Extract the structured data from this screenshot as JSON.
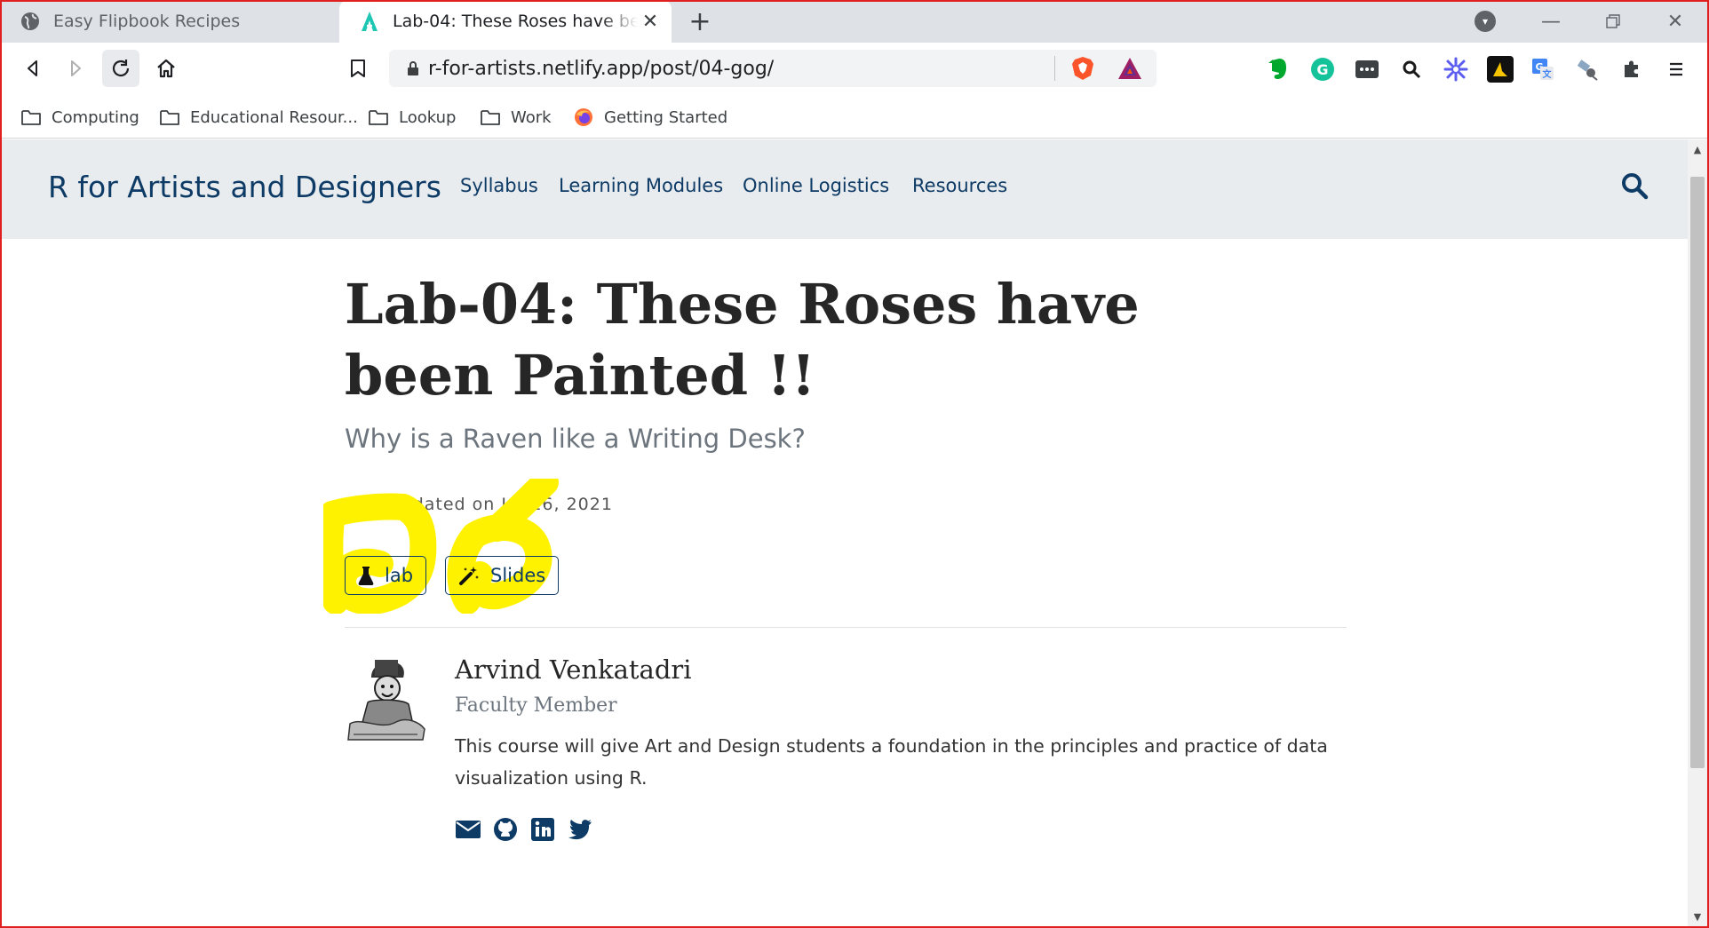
{
  "browser": {
    "tabs": [
      {
        "title": "Easy Flipbook Recipes",
        "favicon": "globe-icon",
        "active": false
      },
      {
        "title": "Lab-04: These Roses have been Pa",
        "favicon": "site-a-icon",
        "active": true
      }
    ],
    "new_tab_symbol": "+",
    "close_symbol": "✕",
    "url": "r-for-artists.netlify.app/post/04-gog/",
    "bookmarks": [
      {
        "label": "Computing",
        "icon": "folder-icon"
      },
      {
        "label": "Educational Resour...",
        "icon": "folder-icon"
      },
      {
        "label": "Lookup",
        "icon": "folder-icon"
      },
      {
        "label": "Work",
        "icon": "folder-icon"
      },
      {
        "label": "Getting Started",
        "icon": "firefox-icon"
      }
    ],
    "extensions": [
      "evernote-icon",
      "grammarly-icon",
      "password-icon",
      "search-ext-icon",
      "snowflake-icon",
      "vector-icon",
      "translate-icon",
      "satellite-icon",
      "puzzle-icon",
      "menu-icon"
    ],
    "colors": {
      "tabstrip": "#dee1e6",
      "accent_red": "#e02020"
    }
  },
  "site": {
    "brand": "R for Artists and Designers",
    "nav": [
      "Syllabus",
      "Learning Modules",
      "Online Logistics",
      "Resources"
    ],
    "colors": {
      "navbar_bg": "#e9ecef",
      "primary": "#0d3b66",
      "highlight": "#fff200"
    }
  },
  "post": {
    "title": "Lab-04: These Roses have been Painted !!",
    "subtitle": "Why is a Raven like a Writing Desk?",
    "updated": "Last updated on Jul 16, 2021",
    "buttons": [
      {
        "label": "lab",
        "icon": "flask-icon"
      },
      {
        "label": "Slides",
        "icon": "magic-wand-icon"
      }
    ],
    "author": {
      "name": "Arvind Venkatadri",
      "role": "Faculty Member",
      "bio": "This course will give Art and Design students a foundation in the principles and practice of data visualization using R.",
      "social": [
        "envelope-icon",
        "github-icon",
        "linkedin-icon",
        "twitter-icon"
      ]
    }
  }
}
